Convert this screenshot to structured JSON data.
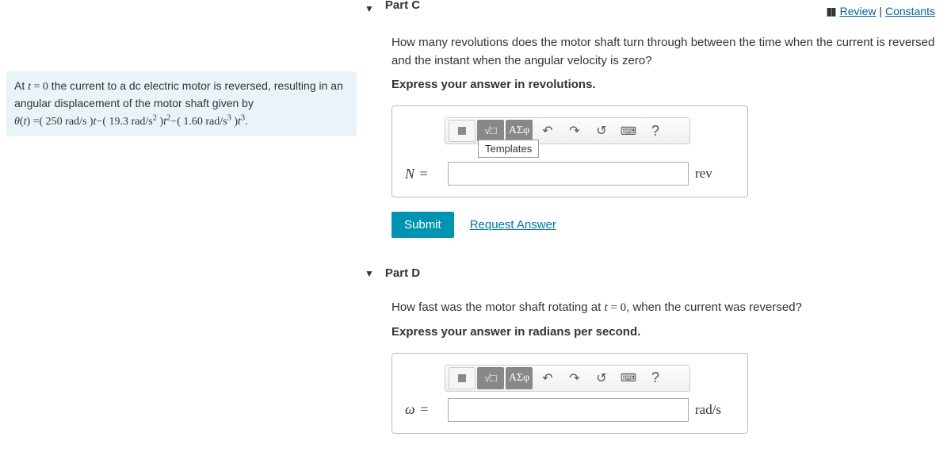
{
  "topLinks": {
    "review": "Review",
    "constants": "Constants"
  },
  "problem": {
    "line1_pre": "At ",
    "line1_math": "t = 0",
    "line1_post": " the current to a dc electric motor is reversed, resulting in an angular displacement of the motor shaft given by",
    "line2": "θ(t) =( 250 rad/s )t−( 19.3 rad/s² )t²−( 1.60 rad/s³ )t³."
  },
  "partC": {
    "label": "Part C",
    "question": "How many revolutions does the motor shaft turn through between the time when the current is reversed and the instant when the angular velocity is zero?",
    "instruction": "Express your answer in revolutions.",
    "toolbar": {
      "sigma": "ΑΣφ",
      "undo": "↶",
      "redo": "↷",
      "reset": "↺",
      "keyboard": "⌨",
      "help": "?",
      "templates": "Templates"
    },
    "varLabel": "N",
    "eq": "=",
    "unit": "rev",
    "submit": "Submit",
    "request": "Request Answer"
  },
  "partD": {
    "label": "Part D",
    "question_pre": "How fast was the motor shaft rotating at ",
    "question_math": "t = 0",
    "question_post": ", when the current was reversed?",
    "instruction": "Express your answer in radians per second.",
    "toolbar": {
      "sigma": "ΑΣφ",
      "undo": "↶",
      "redo": "↷",
      "reset": "↺",
      "keyboard": "⌨",
      "help": "?"
    },
    "varLabel": "ω",
    "eq": "=",
    "unit": "rad/s"
  }
}
